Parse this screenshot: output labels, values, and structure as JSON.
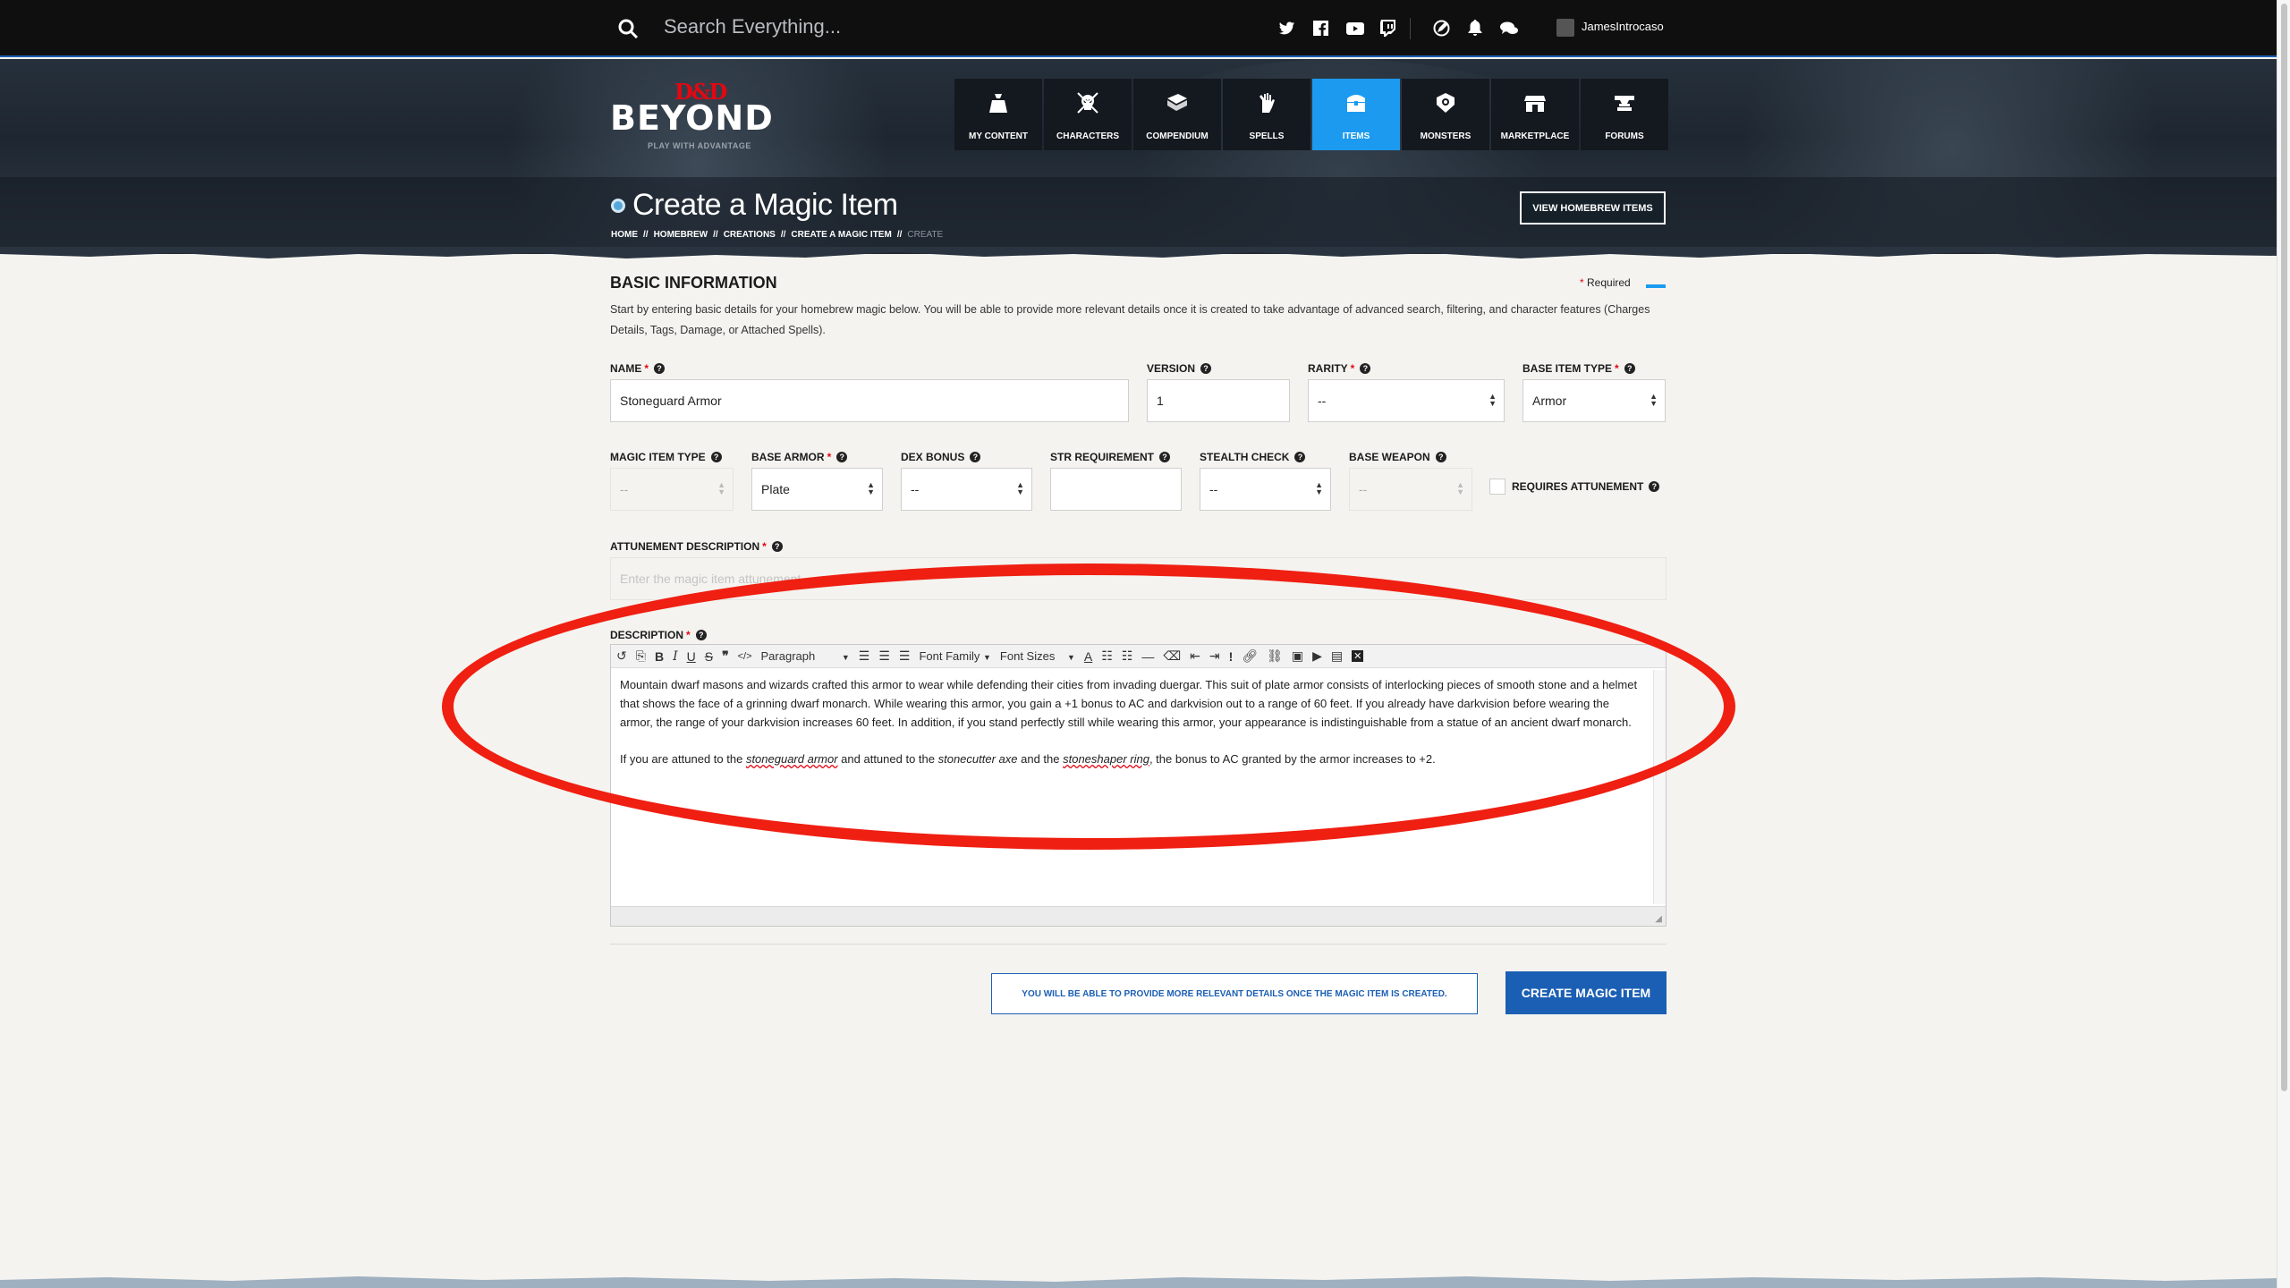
{
  "topbar": {
    "search_placeholder": "Search Everything...",
    "username": "JamesIntrocaso",
    "social_icons": [
      "twitter-icon",
      "facebook-icon",
      "youtube-icon",
      "twitch-icon"
    ],
    "util_icons": [
      "edit-icon",
      "bell-icon",
      "chat-icon"
    ]
  },
  "logo": {
    "mark": "D&D",
    "name": "BEYOND",
    "tagline": "PLAY WITH ADVANTAGE"
  },
  "nav": [
    {
      "label": "MY CONTENT",
      "icon": "bag-icon"
    },
    {
      "label": "CHARACTERS",
      "icon": "skull-icon"
    },
    {
      "label": "COMPENDIUM",
      "icon": "book-icon"
    },
    {
      "label": "SPELLS",
      "icon": "hand-icon"
    },
    {
      "label": "ITEMS",
      "icon": "chest-icon",
      "active": true
    },
    {
      "label": "MONSTERS",
      "icon": "monster-icon"
    },
    {
      "label": "MARKETPLACE",
      "icon": "shop-icon"
    },
    {
      "label": "FORUMS",
      "icon": "anvil-icon"
    }
  ],
  "page": {
    "title": "Create a Magic Item",
    "breadcrumbs": [
      "HOME",
      "HOMEBREW",
      "CREATIONS",
      "CREATE A MAGIC ITEM",
      "CREATE"
    ],
    "view_button": "VIEW HOMEBREW ITEMS"
  },
  "form": {
    "section_title": "BASIC INFORMATION",
    "required_label": "Required",
    "intro": "Start by entering basic details for your homebrew magic below. You will be able to provide more relevant details once it is created to take advantage of advanced search, filtering, and character features (Charges Details, Tags, Damage, or Attached Spells).",
    "name": {
      "label": "NAME",
      "value": "Stoneguard Armor"
    },
    "version": {
      "label": "VERSION",
      "value": "1"
    },
    "rarity": {
      "label": "RARITY",
      "value": "--"
    },
    "base_item_type": {
      "label": "BASE ITEM TYPE",
      "value": "Armor"
    },
    "magic_item_type": {
      "label": "MAGIC ITEM TYPE",
      "value": "--"
    },
    "base_armor": {
      "label": "BASE ARMOR",
      "value": "Plate"
    },
    "dex_bonus": {
      "label": "DEX BONUS",
      "value": "--"
    },
    "str_requirement": {
      "label": "STR REQUIREMENT",
      "value": ""
    },
    "stealth_check": {
      "label": "STEALTH CHECK",
      "value": "--"
    },
    "base_weapon": {
      "label": "BASE WEAPON",
      "value": "--"
    },
    "requires_attunement": {
      "label": "REQUIRES ATTUNEMENT",
      "checked": false
    },
    "attunement_description": {
      "label": "ATTUNEMENT DESCRIPTION",
      "placeholder": "Enter the magic item attunement"
    },
    "description": {
      "label": "DESCRIPTION",
      "toolbar": {
        "paragraph": "Paragraph",
        "font_family": "Font Family",
        "font_sizes": "Font Sizes"
      },
      "p1": "Mountain dwarf masons and wizards crafted this armor to wear while defending their cities from invading duergar. This suit of plate armor consists of interlocking pieces of smooth stone and a helmet that shows the face of a grinning dwarf monarch. While wearing this armor, you gain a +1 bonus to AC and darkvision out to a range of 60 feet. If you already have darkvision before wearing the armor, the range of your darkvision increases 60 feet. In addition, if you stand perfectly still while wearing this armor, your appearance is indistinguishable from a statue of an ancient dwarf monarch.",
      "p2_a": "If you are attuned to the ",
      "p2_link1": "stoneguard armor",
      "p2_b": " and attuned to the ",
      "p2_link2": "stonecutter axe",
      "p2_c": " and the ",
      "p2_link3": "stoneshaper ring",
      "p2_d": ", the bonus to AC granted by the armor increases to +2."
    },
    "info_box": "YOU WILL BE ABLE TO PROVIDE MORE RELEVANT DETAILS ONCE THE MAGIC ITEM IS CREATED.",
    "create_button": "CREATE MAGIC ITEM"
  },
  "colors": {
    "accent": "#1b9af0",
    "brand_red": "#e40712",
    "button_blue": "#1b5fb4",
    "annotation_red": "#ef1f12"
  }
}
